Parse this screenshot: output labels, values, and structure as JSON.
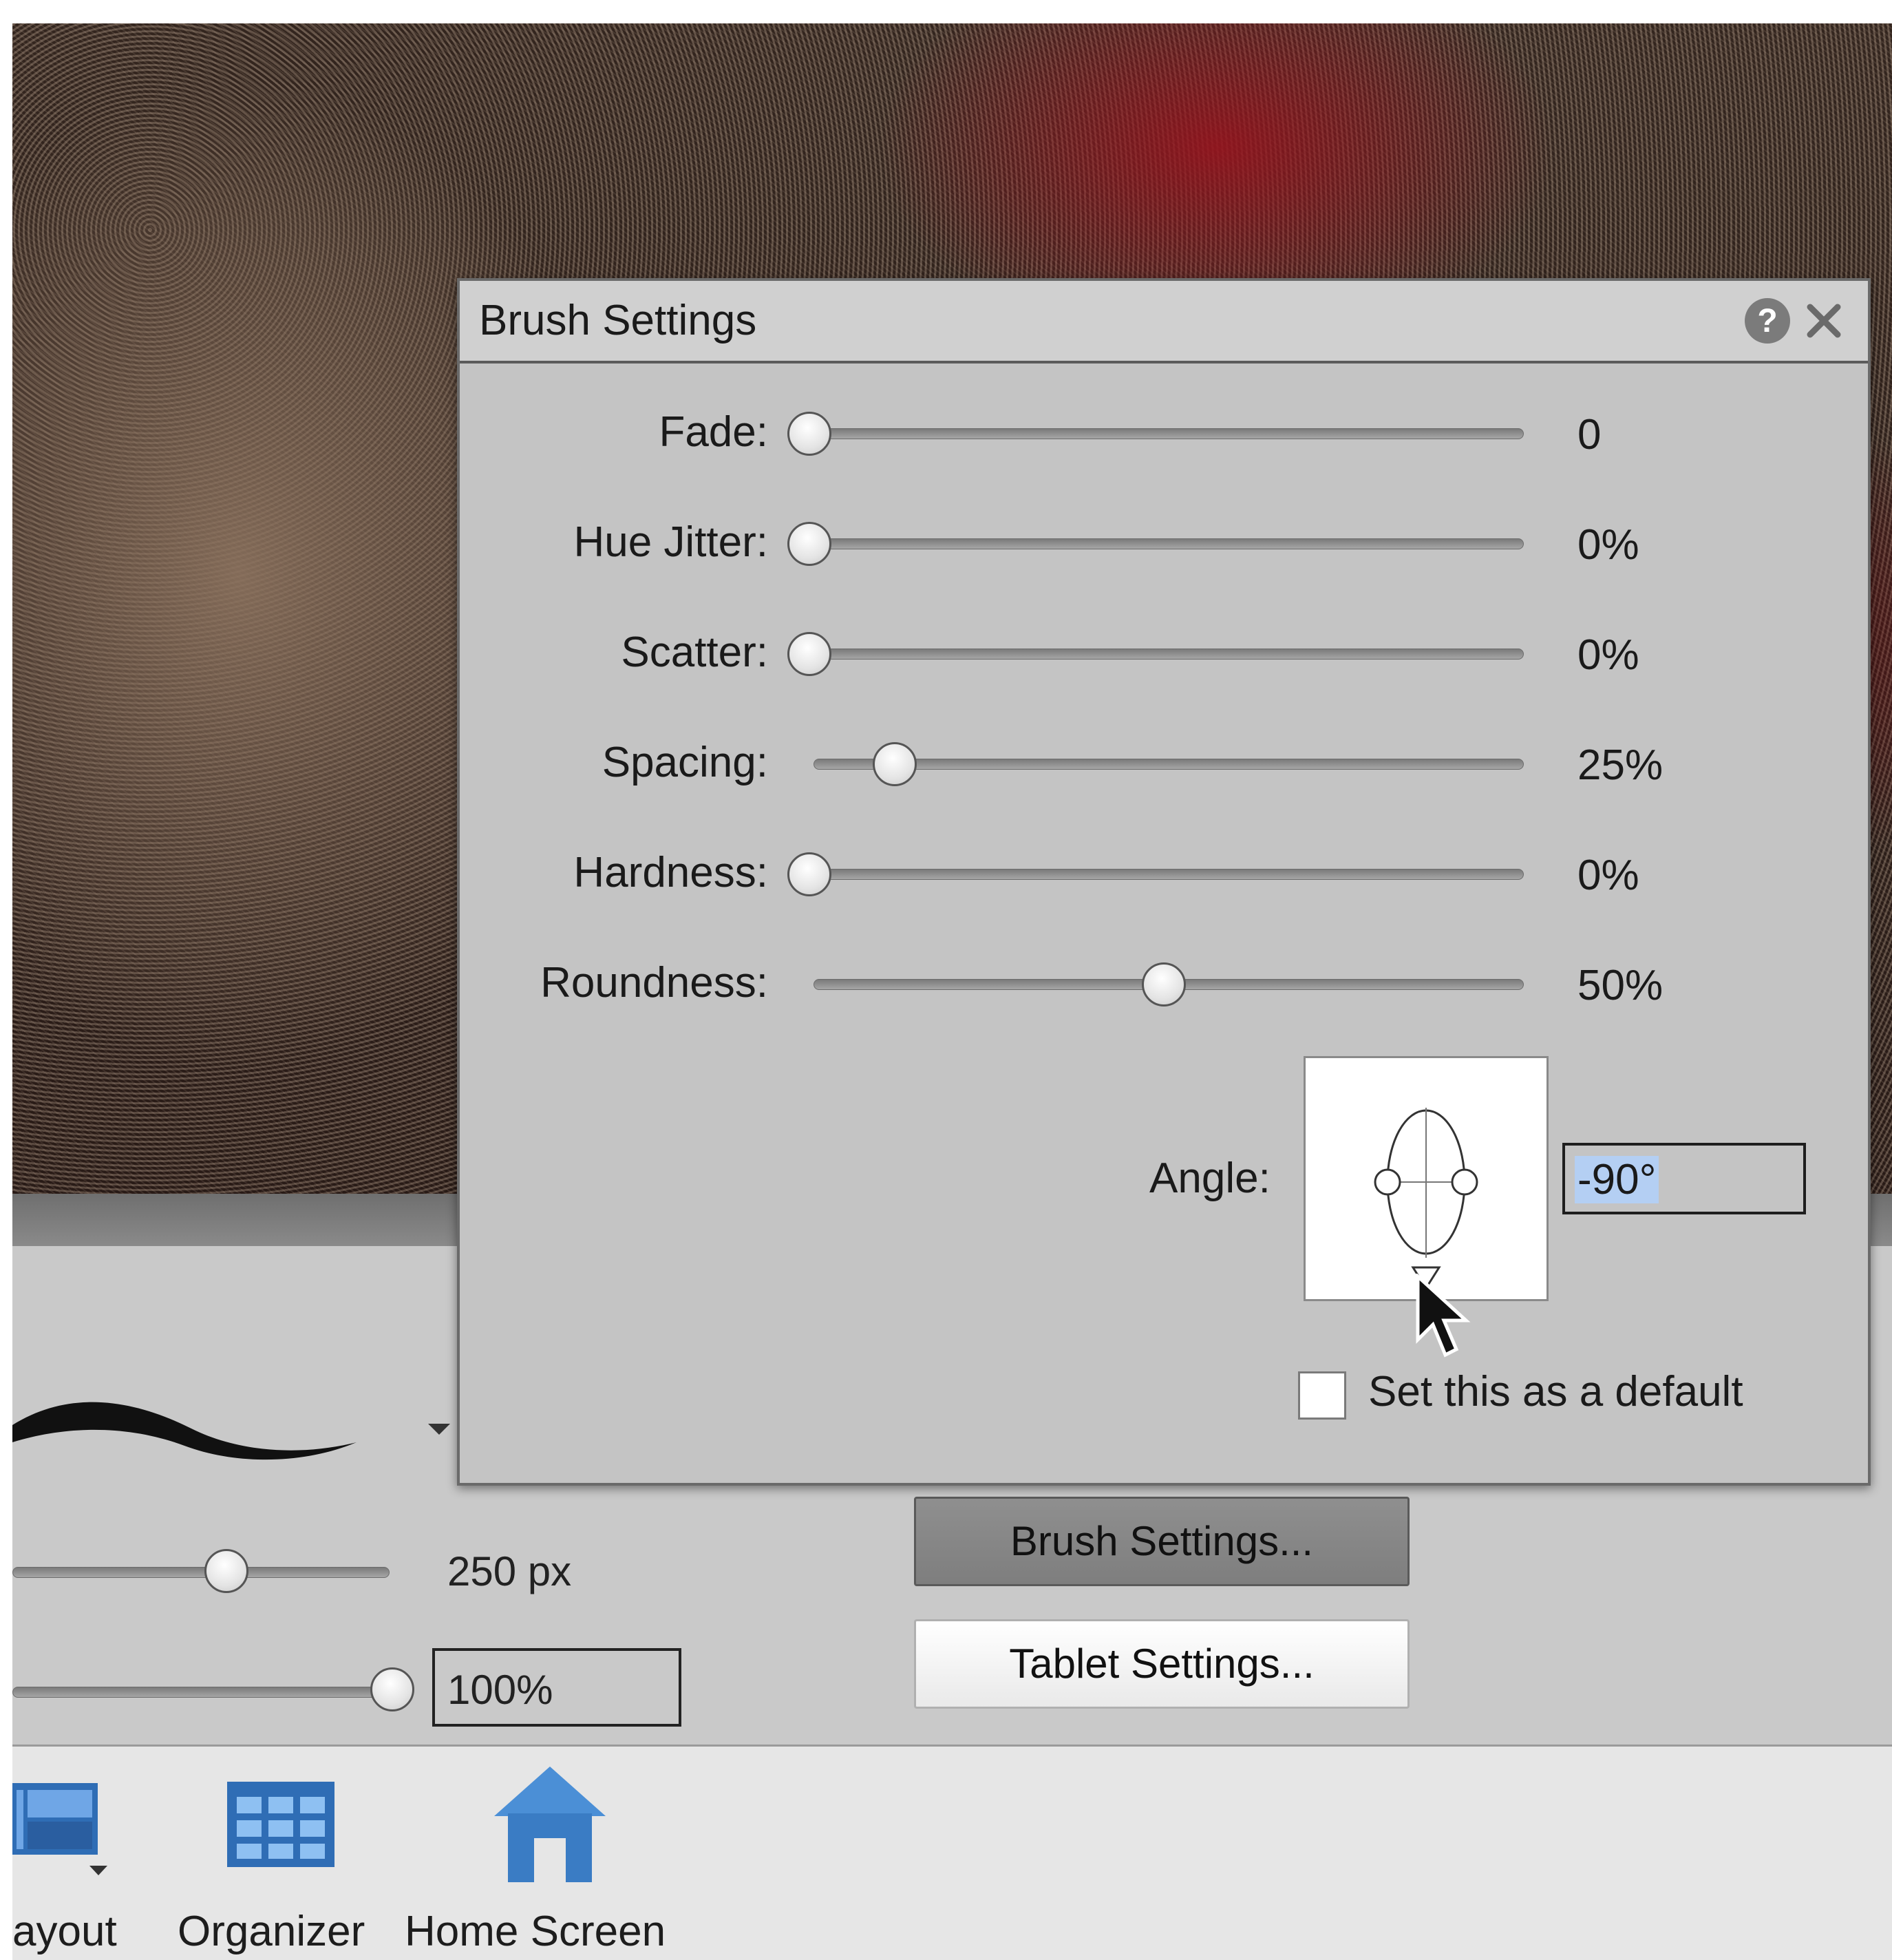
{
  "dialog": {
    "title": "Brush Settings",
    "help_icon": "question-icon",
    "close_icon": "close-icon",
    "sliders": [
      {
        "label": "Fade:",
        "value": "0",
        "level": 0.0
      },
      {
        "label": "Hue Jitter:",
        "value": "0%",
        "level": 0.0
      },
      {
        "label": "Scatter:",
        "value": "0%",
        "level": 0.0
      },
      {
        "label": "Spacing:",
        "value": "25%",
        "level": 0.12
      },
      {
        "label": "Hardness:",
        "value": "0%",
        "level": 0.0
      },
      {
        "label": "Roundness:",
        "value": "50%",
        "level": 0.5
      }
    ],
    "angle": {
      "label": "Angle:",
      "value": "-90°"
    },
    "default_checkbox": {
      "label": "Set this as a default",
      "checked": false
    }
  },
  "options": {
    "size_value": "250 px",
    "size_level": 0.57,
    "opacity_value": "100%",
    "opacity_level": 1.0,
    "brush_settings_button": "Brush Settings...",
    "tablet_settings_button": "Tablet Settings..."
  },
  "taskbar": {
    "items": [
      {
        "label": "ayout",
        "icon": "layout-icon"
      },
      {
        "label": "Organizer",
        "icon": "organizer-grid-icon"
      },
      {
        "label": "Home Screen",
        "icon": "home-icon"
      }
    ]
  },
  "colors": {
    "dialog_bg": "#c4c4c4",
    "panel_bg": "#c9c9c9",
    "taskbar_bg": "#e6e6e6",
    "icon_blue": "#2f6db5",
    "selection_highlight": "#b4cff3"
  }
}
